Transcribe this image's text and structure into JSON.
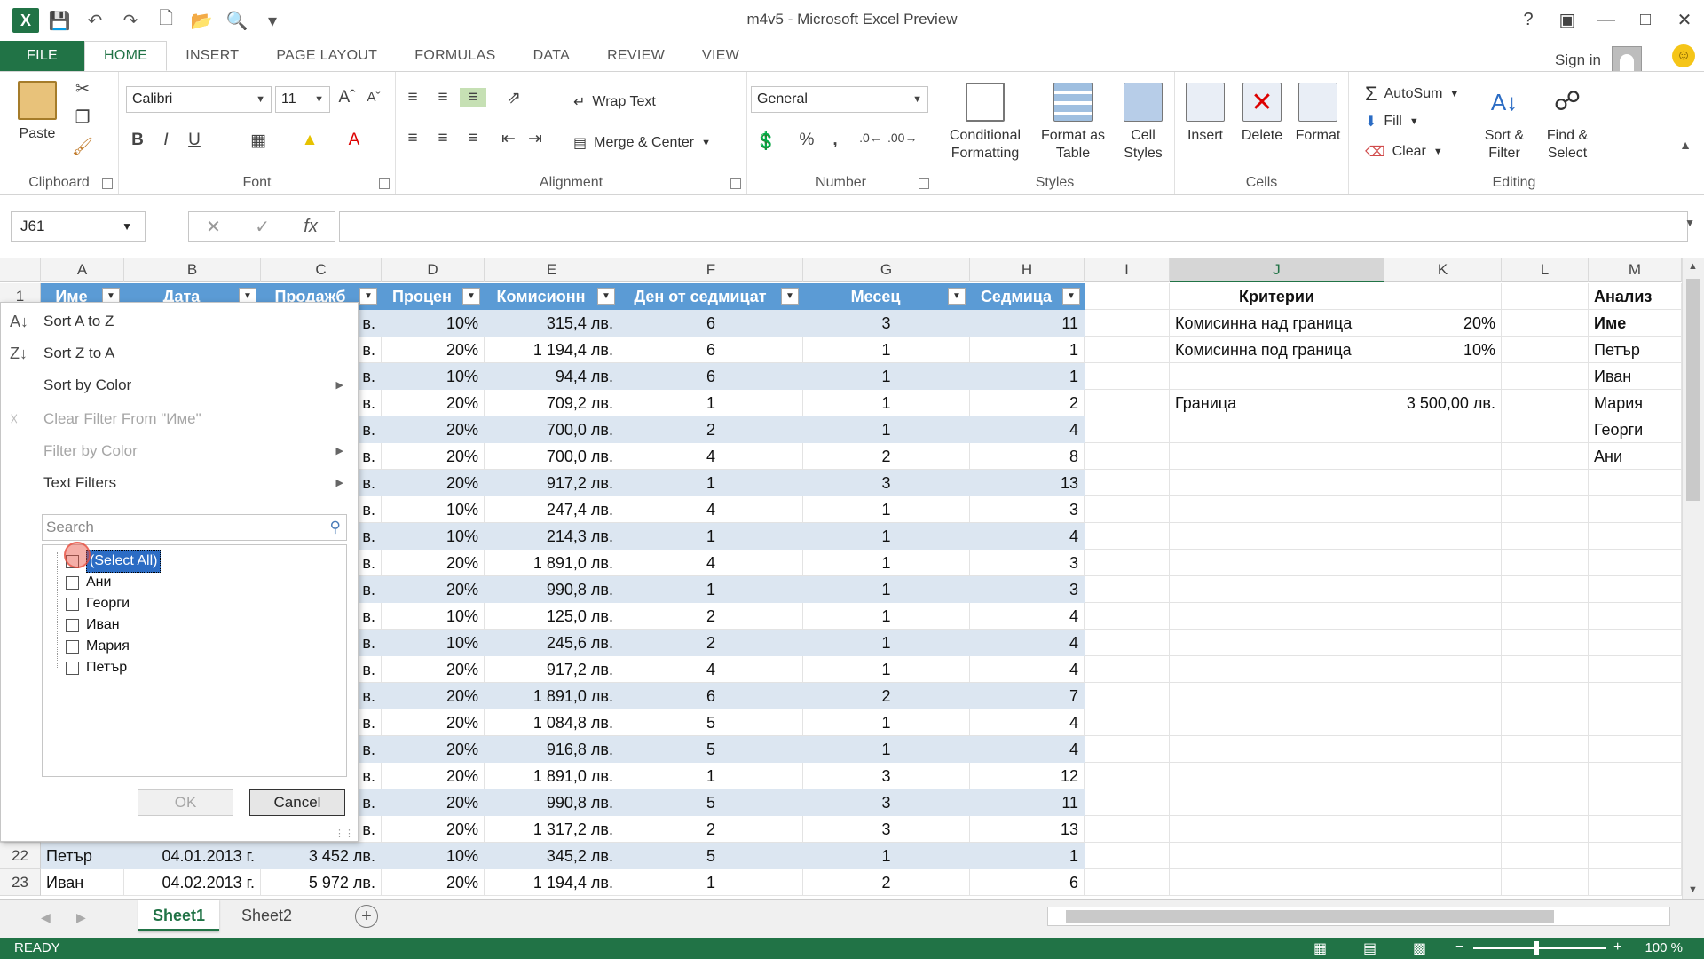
{
  "window": {
    "title": "m4v5 - Microsoft Excel Preview",
    "help": "?",
    "sign_in": "Sign in"
  },
  "ribbon_tabs": [
    "FILE",
    "HOME",
    "INSERT",
    "PAGE LAYOUT",
    "FORMULAS",
    "DATA",
    "REVIEW",
    "VIEW"
  ],
  "ribbon": {
    "clipboard": {
      "label": "Clipboard",
      "paste": "Paste"
    },
    "font": {
      "label": "Font",
      "family": "Calibri",
      "size": "11",
      "bold": "B",
      "italic": "I",
      "underline": "U"
    },
    "alignment": {
      "label": "Alignment",
      "wrap_text": "Wrap Text",
      "merge_center": "Merge & Center"
    },
    "number": {
      "label": "Number",
      "format": "General",
      "percent": "%",
      "comma": ","
    },
    "styles": {
      "label": "Styles",
      "conditional_1": "Conditional",
      "conditional_2": "Formatting",
      "format_table_1": "Format as",
      "format_table_2": "Table",
      "cell_styles_1": "Cell",
      "cell_styles_2": "Styles"
    },
    "cells": {
      "label": "Cells",
      "insert": "Insert",
      "delete": "Delete",
      "format": "Format"
    },
    "editing": {
      "label": "Editing",
      "autosum": "AutoSum",
      "fill": "Fill",
      "clear": "Clear",
      "sort_1": "Sort &",
      "sort_2": "Filter",
      "find_1": "Find &",
      "find_2": "Select"
    }
  },
  "formula_bar": {
    "name_box": "J61",
    "fx": "fx",
    "value": ""
  },
  "columns": [
    "A",
    "B",
    "C",
    "D",
    "E",
    "F",
    "G",
    "H",
    "I",
    "J",
    "K",
    "L",
    "M"
  ],
  "selected_column": "J",
  "table_headers": [
    "Име",
    "Дата",
    "Продажб",
    "Процен",
    "Комисионн",
    "Ден от седмицат",
    "Месец",
    "Седмица"
  ],
  "row_numbers": [
    "1",
    "22",
    "23"
  ],
  "visible_rows": [
    {
      "d": "в.",
      "pct": "10%",
      "comm": "315,4 лв.",
      "day": "6",
      "month": "3",
      "week": "11"
    },
    {
      "d": "в.",
      "pct": "20%",
      "comm": "1 194,4 лв.",
      "day": "6",
      "month": "1",
      "week": "1"
    },
    {
      "d": "в.",
      "pct": "10%",
      "comm": "94,4 лв.",
      "day": "6",
      "month": "1",
      "week": "1"
    },
    {
      "d": "в.",
      "pct": "20%",
      "comm": "709,2 лв.",
      "day": "1",
      "month": "1",
      "week": "2"
    },
    {
      "d": "в.",
      "pct": "20%",
      "comm": "700,0 лв.",
      "day": "2",
      "month": "1",
      "week": "4"
    },
    {
      "d": "в.",
      "pct": "20%",
      "comm": "700,0 лв.",
      "day": "4",
      "month": "2",
      "week": "8"
    },
    {
      "d": "в.",
      "pct": "20%",
      "comm": "917,2 лв.",
      "day": "1",
      "month": "3",
      "week": "13"
    },
    {
      "d": "в.",
      "pct": "10%",
      "comm": "247,4 лв.",
      "day": "4",
      "month": "1",
      "week": "3"
    },
    {
      "d": "в.",
      "pct": "10%",
      "comm": "214,3 лв.",
      "day": "1",
      "month": "1",
      "week": "4"
    },
    {
      "d": "в.",
      "pct": "20%",
      "comm": "1 891,0 лв.",
      "day": "4",
      "month": "1",
      "week": "3"
    },
    {
      "d": "в.",
      "pct": "20%",
      "comm": "990,8 лв.",
      "day": "1",
      "month": "1",
      "week": "3"
    },
    {
      "d": "в.",
      "pct": "10%",
      "comm": "125,0 лв.",
      "day": "2",
      "month": "1",
      "week": "4"
    },
    {
      "d": "в.",
      "pct": "10%",
      "comm": "245,6 лв.",
      "day": "2",
      "month": "1",
      "week": "4"
    },
    {
      "d": "в.",
      "pct": "20%",
      "comm": "917,2 лв.",
      "day": "4",
      "month": "1",
      "week": "4"
    },
    {
      "d": "в.",
      "pct": "20%",
      "comm": "1 891,0 лв.",
      "day": "6",
      "month": "2",
      "week": "7"
    },
    {
      "d": "в.",
      "pct": "20%",
      "comm": "1 084,8 лв.",
      "day": "5",
      "month": "1",
      "week": "4"
    },
    {
      "d": "в.",
      "pct": "20%",
      "comm": "916,8 лв.",
      "day": "5",
      "month": "1",
      "week": "4"
    },
    {
      "d": "в.",
      "pct": "20%",
      "comm": "1 891,0 лв.",
      "day": "1",
      "month": "3",
      "week": "12"
    },
    {
      "d": "в.",
      "pct": "20%",
      "comm": "990,8 лв.",
      "day": "5",
      "month": "3",
      "week": "11"
    },
    {
      "d": "в.",
      "pct": "20%",
      "comm": "1 317,2 лв.",
      "day": "2",
      "month": "3",
      "week": "13"
    }
  ],
  "full_rows": [
    {
      "num": "22",
      "name": "Петър",
      "date": "04.01.2013 г.",
      "sales": "3 452 лв.",
      "pct": "10%",
      "comm": "345,2 лв.",
      "day": "5",
      "month": "1",
      "week": "1"
    },
    {
      "num": "23",
      "name": "Иван",
      "date": "04.02.2013 г.",
      "sales": "5 972 лв.",
      "pct": "20%",
      "comm": "1 194,4 лв.",
      "day": "1",
      "month": "2",
      "week": "6"
    }
  ],
  "criteria": {
    "title": "Критерии",
    "upper_label": "Комисинна над граница",
    "upper_value": "20%",
    "lower_label": "Комисинна под граница",
    "lower_value": "10%",
    "limit_label": "Граница",
    "limit_value": "3 500,00 лв."
  },
  "analysis": {
    "title": "Анализ",
    "header": "Име",
    "names": [
      "Петър",
      "Иван",
      "Мария",
      "Георги",
      "Ани"
    ]
  },
  "filter_menu": {
    "sort_az": "Sort A to Z",
    "sort_za": "Sort Z to A",
    "sort_color": "Sort by Color",
    "clear_filter": "Clear Filter From \"Име\"",
    "filter_color": "Filter by Color",
    "text_filters": "Text Filters",
    "search_placeholder": "Search",
    "items": [
      "(Select All)",
      "Ани",
      "Георги",
      "Иван",
      "Мария",
      "Петър"
    ],
    "ok": "OK",
    "cancel": "Cancel"
  },
  "sheets": [
    "Sheet1",
    "Sheet2"
  ],
  "active_sheet": "Sheet1",
  "status": {
    "ready": "READY",
    "zoom": "100 %"
  },
  "colors": {
    "excel_green": "#217346",
    "table_header": "#5b9bd5",
    "band": "#dce6f1"
  }
}
